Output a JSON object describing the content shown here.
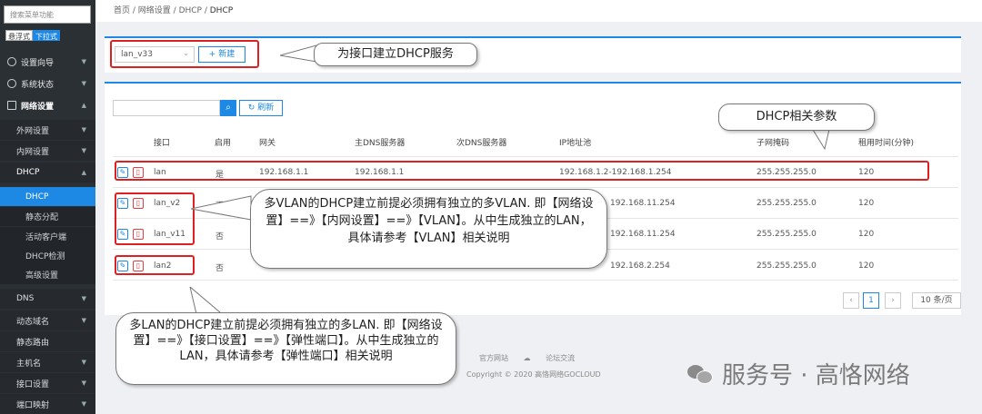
{
  "sidebar": {
    "search_placeholder": "搜索菜单功能",
    "mode_tabs": [
      "悬浮式",
      "下拉式"
    ],
    "top_items": [
      {
        "label": "设置向导"
      },
      {
        "label": "系统状态"
      },
      {
        "label": "网络设置"
      }
    ],
    "sub_items": [
      {
        "label": "外网设置"
      },
      {
        "label": "内网设置"
      },
      {
        "label": "DHCP"
      }
    ],
    "dhcp_items": [
      {
        "label": "DHCP"
      },
      {
        "label": "静态分配"
      },
      {
        "label": "活动客户端"
      },
      {
        "label": "DHCP检测"
      },
      {
        "label": "高级设置"
      }
    ],
    "lower_items": [
      {
        "label": "DNS"
      },
      {
        "label": "动态域名"
      },
      {
        "label": "静态路由"
      },
      {
        "label": "主机名"
      },
      {
        "label": "接口设置"
      },
      {
        "label": "端口映射"
      }
    ]
  },
  "breadcrumb": [
    "首页",
    "网络设置",
    "DHCP",
    "DHCP"
  ],
  "top_panel": {
    "interface_select": "lan_v33",
    "new_button": "新建"
  },
  "list_panel": {
    "refresh_button": "刷新",
    "columns": [
      "接口",
      "启用",
      "网关",
      "主DNS服务器",
      "次DNS服务器",
      "IP地址池",
      "子网掩码",
      "租用时间(分钟)"
    ],
    "rows": [
      {
        "iface": "lan",
        "enabled": "是",
        "gateway": "192.168.1.1",
        "dns1": "192.168.1.1",
        "dns2": "",
        "pool": "192.168.1.2-192.168.1.254",
        "mask": "255.255.255.0",
        "lease": "120"
      },
      {
        "iface": "lan_v2",
        "enabled": "否",
        "gateway": "",
        "dns1": "",
        "dns2": "",
        "pool": "192.168.11.254",
        "mask": "255.255.255.0",
        "lease": "120"
      },
      {
        "iface": "lan_v11",
        "enabled": "否",
        "gateway": "",
        "dns1": "",
        "dns2": "",
        "pool": "192.168.11.254",
        "mask": "255.255.255.0",
        "lease": "120"
      },
      {
        "iface": "lan2",
        "enabled": "否",
        "gateway": "",
        "dns1": "",
        "dns2": "",
        "pool": "192.168.2.254",
        "mask": "255.255.255.0",
        "lease": "120"
      }
    ],
    "pagination": {
      "current_page": "1",
      "page_size": "10 条/页"
    }
  },
  "footer": {
    "links": [
      "官方网站",
      "论坛交流"
    ],
    "copyright": "Copyright © 2020 高恪网络GOCLOUD"
  },
  "callouts": {
    "dhcp_service": "为接口建立DHCP服务",
    "dhcp_params": "DHCP相关参数",
    "vlan_note": "多VLAN的DHCP建立前提必须拥有独立的多VLAN. 即【网络设置】==》【内网设置】==》【VLAN】。从中生成独立的LAN，具体请参考【VLAN】相关说明",
    "lan_note": "多LAN的DHCP建立前提必须拥有独立的多LAN. 即【网络设置】==》【接口设置】==》【弹性端口】。从中生成独立的LAN，具体请参考【弹性端口】相关说明"
  },
  "watermark": "服务号 · 高恪网络",
  "colors": {
    "accent": "#1e88e5",
    "highlight": "#e02020",
    "sidebar": "#2b3035"
  }
}
